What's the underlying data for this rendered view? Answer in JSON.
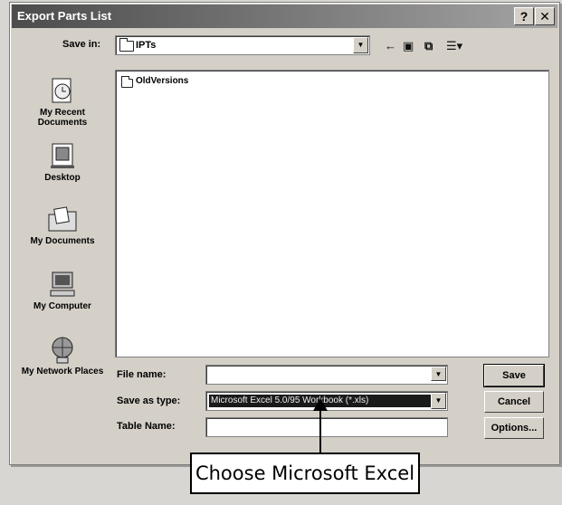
{
  "window": {
    "title": "Export Parts List",
    "help_button": "?",
    "close_button": "✕"
  },
  "toolbar": {
    "save_in_label": "Save in:",
    "save_in_value": "IPTs",
    "back_icon": "back-arrow-icon",
    "up_icon": "up-folder-icon",
    "new_folder_icon": "new-folder-icon",
    "views_icon": "views-menu-icon"
  },
  "places": [
    {
      "label": "My Recent Documents",
      "icon": "recent-documents-icon"
    },
    {
      "label": "Desktop",
      "icon": "desktop-icon"
    },
    {
      "label": "My Documents",
      "icon": "my-documents-icon"
    },
    {
      "label": "My Computer",
      "icon": "my-computer-icon"
    },
    {
      "label": "My Network Places",
      "icon": "network-places-icon"
    }
  ],
  "file_list": {
    "items": [
      {
        "name": "OldVersions",
        "type": "folder"
      }
    ]
  },
  "form": {
    "file_name_label": "File name:",
    "file_name_value": "",
    "save_as_type_label": "Save as type:",
    "save_as_type_value": "Microsoft Excel 5.0/95 Workbook (*.xls)",
    "table_name_label": "Table Name:",
    "table_name_value": ""
  },
  "buttons": {
    "save": "Save",
    "cancel": "Cancel",
    "options": "Options..."
  },
  "annotation": {
    "callout_text": "Choose Microsoft Excel"
  }
}
